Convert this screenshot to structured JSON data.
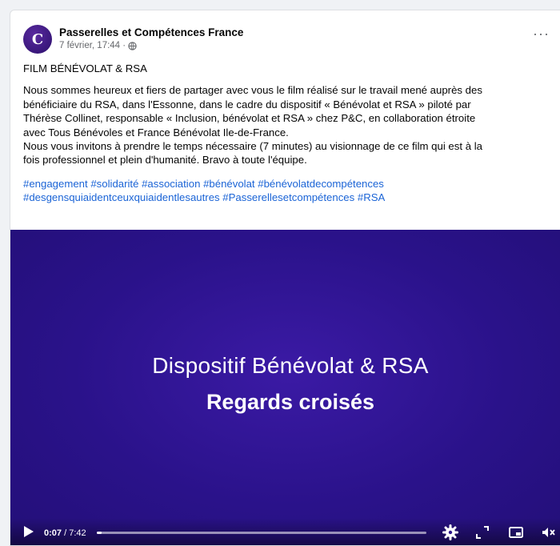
{
  "post": {
    "page_name": "Passerelles et Compétences France",
    "date": "7 février, 17:44 ·",
    "avatar_letter": "C",
    "more_label": "···"
  },
  "content": {
    "title": "FILM BÉNÉVOLAT & RSA",
    "paragraph_lines": [
      "Nous sommes heureux et fiers de partager avec vous le film réalisé sur le travail mené auprès des",
      "bénéficiaire du RSA, dans l'Essonne, dans le cadre du dispositif « Bénévolat et RSA » piloté par",
      "Thérèse Collinet, responsable « Inclusion, bénévolat et RSA » chez P&C,  en collaboration étroite",
      "avec Tous Bénévoles et France Bénévolat Ile-de-France.",
      "Nous vous invitons à prendre le temps nécessaire (7 minutes) au visionnage de ce film qui est à la",
      "fois professionnel et plein d'humanité. Bravo à toute l'équipe."
    ],
    "hashtag_line_1": "#engagement #solidarité #association #bénévolat  #bénévolatdecompétences",
    "hashtag_line_2": "#desgensquiaidentceuxquiaidentlesautres #Passerellesetcompétences #RSA"
  },
  "video": {
    "title_line_1": "Dispositif Bénévolat & RSA",
    "title_line_2": "Regards croisés",
    "current_time": "0:07",
    "duration": " / 7:42",
    "progress_fraction": 0.015,
    "background_color": "#2a128a"
  },
  "icons": [
    "globe-icon",
    "more-icon",
    "play-icon",
    "settings-icon",
    "expand-icon",
    "miniplayer-icon",
    "volume-icon"
  ],
  "colors": {
    "link": "#1b64d6",
    "text": "#050505",
    "muted": "#65676b"
  }
}
